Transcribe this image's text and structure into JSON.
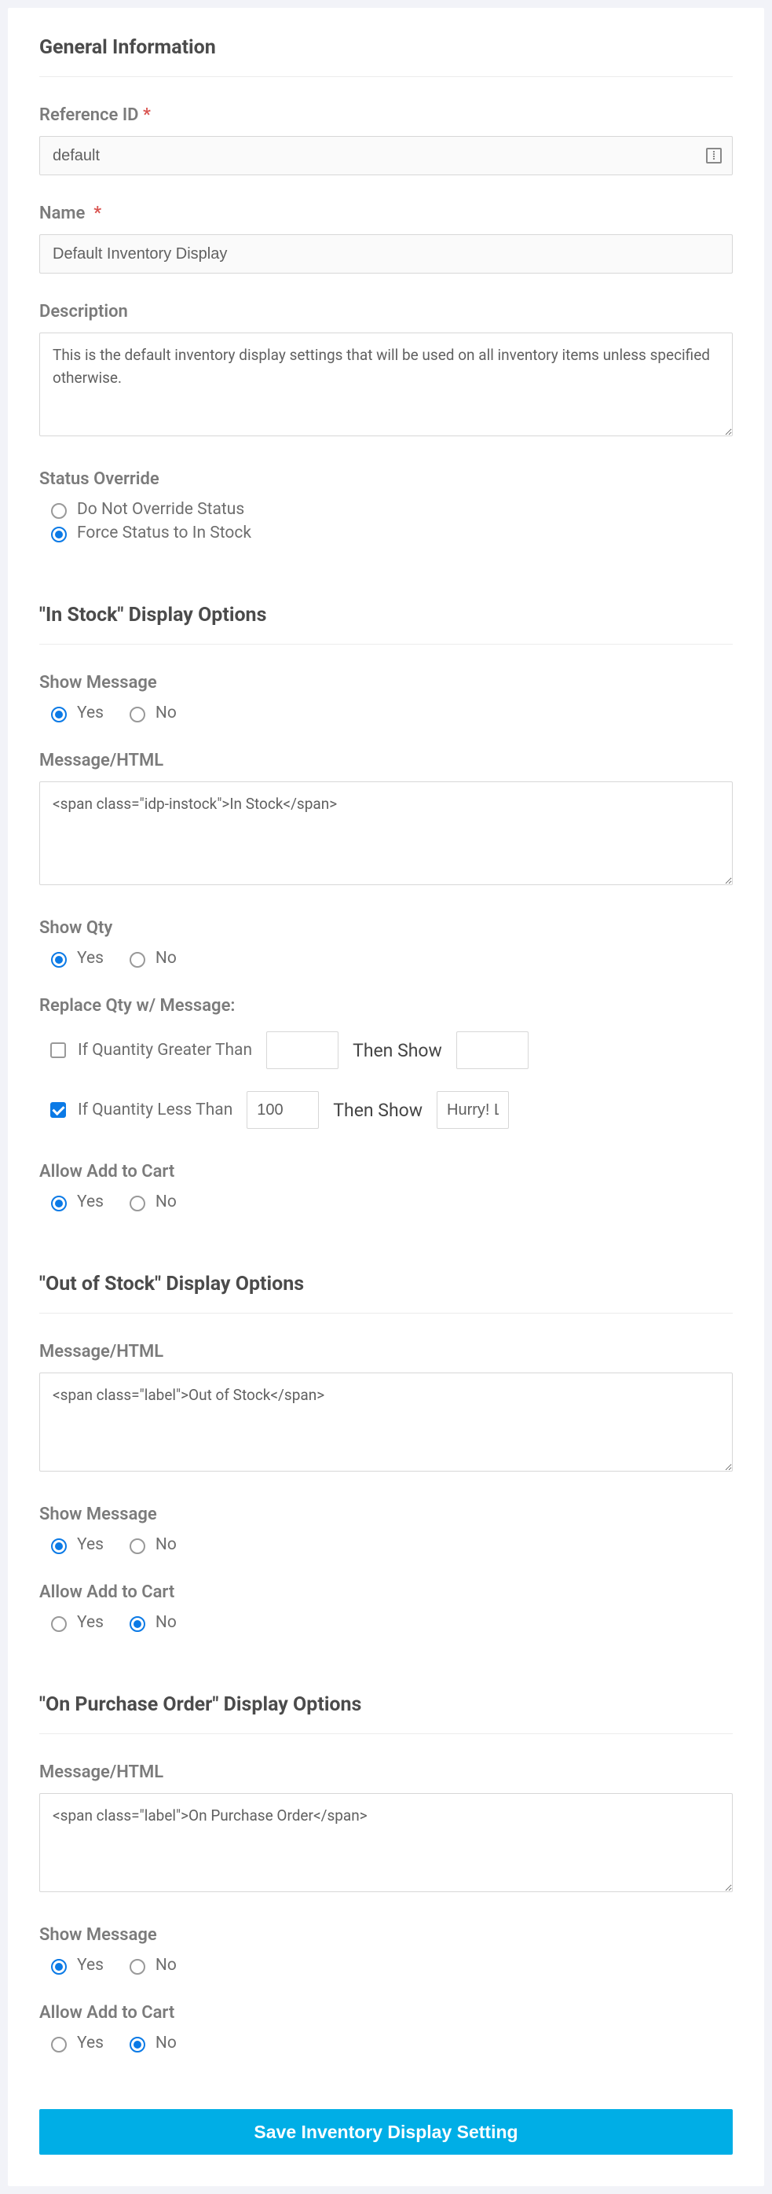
{
  "general": {
    "title": "General Information",
    "ref_label": "Reference ID",
    "ref_value": "default",
    "name_label": "Name",
    "name_value": "Default Inventory Display",
    "desc_label": "Description",
    "desc_value": "This is the default inventory display settings that will be used on all inventory items unless specified otherwise.",
    "status_label": "Status Override",
    "status_opts": [
      "Do Not Override Status",
      "Force Status to In Stock"
    ],
    "status_selected": 1
  },
  "instock": {
    "title": "\"In Stock\" Display Options",
    "show_msg_label": "Show Message",
    "show_msg": "yes",
    "msg_label": "Message/HTML",
    "msg_value": "<span class=\"idp-instock\">In Stock</span>",
    "show_qty_label": "Show Qty",
    "show_qty": "yes",
    "replace_label": "Replace Qty w/ Message:",
    "gt_label": "If Quantity Greater Than",
    "gt_checked": false,
    "gt_value": "",
    "gt_msg": "",
    "lt_label": "If Quantity Less Than",
    "lt_checked": true,
    "lt_value": "100",
    "lt_msg": "Hurry! Le",
    "then_show": "Then Show",
    "allow_cart_label": "Allow Add to Cart",
    "allow_cart": "yes"
  },
  "oos": {
    "title": "\"Out of Stock\" Display Options",
    "msg_label": "Message/HTML",
    "msg_value": "<span class=\"label\">Out of Stock</span>",
    "show_msg_label": "Show Message",
    "show_msg": "yes",
    "allow_cart_label": "Allow Add to Cart",
    "allow_cart": "no"
  },
  "onpo": {
    "title": "\"On Purchase Order\" Display Options",
    "msg_label": "Message/HTML",
    "msg_value": "<span class=\"label\">On Purchase Order</span>",
    "show_msg_label": "Show Message",
    "show_msg": "yes",
    "allow_cart_label": "Allow Add to Cart",
    "allow_cart": "no"
  },
  "common": {
    "yes": "Yes",
    "no": "No",
    "required_mark": "*"
  },
  "save": {
    "label": "Save Inventory Display Setting"
  }
}
